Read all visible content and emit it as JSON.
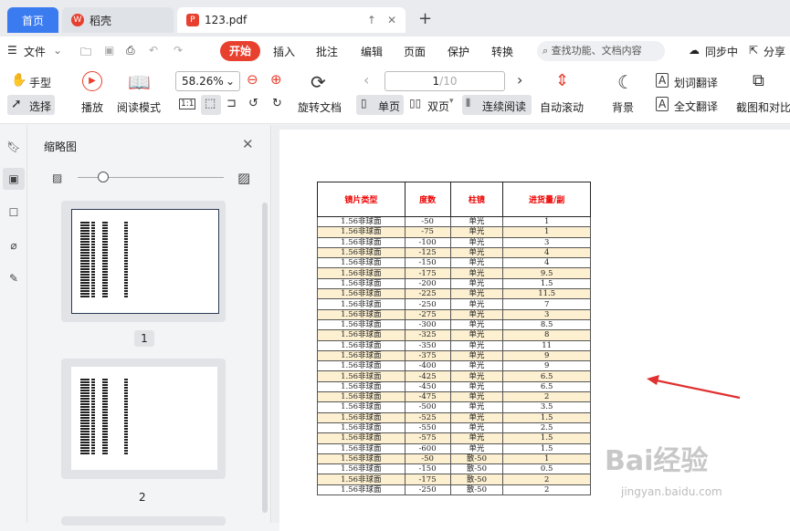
{
  "tabs": {
    "home": "首页",
    "daoke": "稻壳",
    "pdf": "123.pdf",
    "new": "+"
  },
  "menu": {
    "file": "文件",
    "start": "开始",
    "insert": "插入",
    "annotate": "批注",
    "edit": "编辑",
    "page": "页面",
    "protect": "保护",
    "convert": "转换",
    "search": "查找功能、文档内容",
    "sync": "同步中",
    "share": "分享"
  },
  "toolbar": {
    "hand": "手型",
    "select": "选择",
    "play": "播放",
    "read_mode": "阅读模式",
    "zoom": "58.26%",
    "rotate": "旋转文档",
    "page_input": "1",
    "page_total": "/10",
    "single": "单页",
    "double": "双页",
    "continuous": "连续阅读",
    "auto_scroll": "自动滚动",
    "background": "背景",
    "word_translate": "划词翻译",
    "full_translate": "全文翻译",
    "screenshot": "截图和对比"
  },
  "panel": {
    "title": "缩略图",
    "page1": "1",
    "page2": "2"
  },
  "table": {
    "headers": [
      "镜片类型",
      "度数",
      "柱镜",
      "进货量/副"
    ],
    "rows": [
      [
        "1.56非球面",
        "-50",
        "单光",
        "1"
      ],
      [
        "1.56非球面",
        "-75",
        "单光",
        "1"
      ],
      [
        "1.56非球面",
        "-100",
        "单光",
        "3"
      ],
      [
        "1.56非球面",
        "-125",
        "单光",
        "4"
      ],
      [
        "1.56非球面",
        "-150",
        "单光",
        "4"
      ],
      [
        "1.56非球面",
        "-175",
        "单光",
        "9.5"
      ],
      [
        "1.56非球面",
        "-200",
        "单光",
        "1.5"
      ],
      [
        "1.56非球面",
        "-225",
        "单光",
        "11.5"
      ],
      [
        "1.56非球面",
        "-250",
        "单光",
        "7"
      ],
      [
        "1.56非球面",
        "-275",
        "单光",
        "3"
      ],
      [
        "1.56非球面",
        "-300",
        "单光",
        "8.5"
      ],
      [
        "1.56非球面",
        "-325",
        "单光",
        "8"
      ],
      [
        "1.56非球面",
        "-350",
        "单光",
        "11"
      ],
      [
        "1.56非球面",
        "-375",
        "单光",
        "9"
      ],
      [
        "1.56非球面",
        "-400",
        "单光",
        "9"
      ],
      [
        "1.56非球面",
        "-425",
        "单光",
        "6.5"
      ],
      [
        "1.56非球面",
        "-450",
        "单光",
        "6.5"
      ],
      [
        "1.56非球面",
        "-475",
        "单光",
        "2"
      ],
      [
        "1.56非球面",
        "-500",
        "单光",
        "3.5"
      ],
      [
        "1.56非球面",
        "-525",
        "单光",
        "1.5"
      ],
      [
        "1.56非球面",
        "-550",
        "单光",
        "2.5"
      ],
      [
        "1.56非球面",
        "-575",
        "单光",
        "1.5"
      ],
      [
        "1.56非球面",
        "-600",
        "单光",
        "1.5"
      ],
      [
        "1.56非球面",
        "-50",
        "散-50",
        "1"
      ],
      [
        "1.56非球面",
        "-150",
        "散-50",
        "0.5"
      ],
      [
        "1.56非球面",
        "-175",
        "散-50",
        "2"
      ],
      [
        "1.56非球面",
        "-250",
        "散-50",
        "2"
      ]
    ]
  },
  "watermark": {
    "main": "Bai经验",
    "sub": "jingyan.baidu.com"
  },
  "colors": {
    "accent": "#3b7bf0",
    "brand": "#e8402f",
    "header_text": "#ee0000",
    "row_alt": "#fdf0d0",
    "arrow": "#e03030"
  }
}
